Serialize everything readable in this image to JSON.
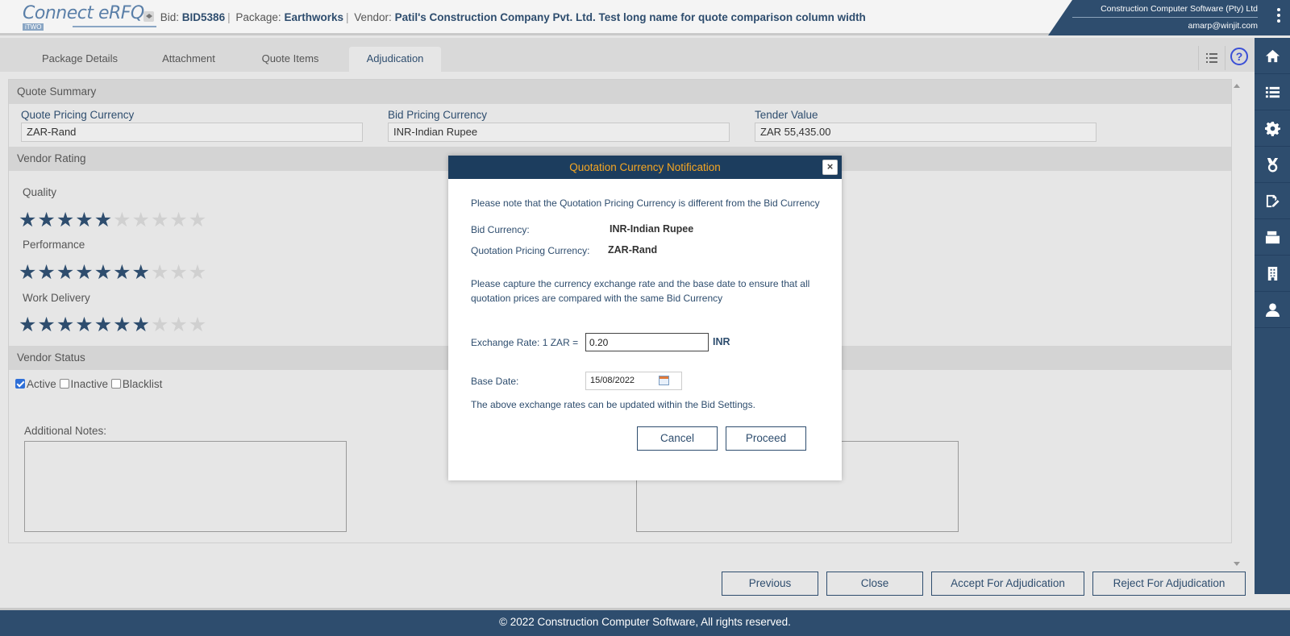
{
  "header": {
    "logo_text": "Connect eRFQ",
    "logo_sub": "iTWO",
    "bid_label": "Bid:",
    "bid_value": "BID5386",
    "package_label": "Package:",
    "package_value": "Earthworks",
    "vendor_label": "Vendor:",
    "vendor_value": "Patil's Construction Company Pvt. Ltd. Test long name for quote comparison column width",
    "company": "Construction Computer Software (Pty) Ltd",
    "user_email": "amarp@winjit.com"
  },
  "tabs": [
    {
      "label": "Package Details"
    },
    {
      "label": "Attachment"
    },
    {
      "label": "Quote Items"
    },
    {
      "label": "Adjudication",
      "active": true
    }
  ],
  "help_glyph": "?",
  "quote_summary": {
    "title": "Quote Summary",
    "quote_currency_label": "Quote Pricing Currency",
    "quote_currency_value": "ZAR-Rand",
    "bid_currency_label": "Bid Pricing Currency",
    "bid_currency_value": "INR-Indian Rupee",
    "tender_label": "Tender Value",
    "tender_value": "ZAR 55,435.00"
  },
  "vendor_rating": {
    "title": "Vendor Rating",
    "max_stars": 10,
    "ratings": [
      {
        "label": "Quality",
        "stars": 5
      },
      {
        "label": "Performance",
        "stars": 7
      },
      {
        "label": "Work Delivery",
        "stars": 7
      }
    ]
  },
  "vendor_status": {
    "title": "Vendor Status",
    "options": [
      {
        "label": "Active",
        "checked": true
      },
      {
        "label": "Inactive",
        "checked": false
      },
      {
        "label": "Blacklist",
        "checked": false
      }
    ]
  },
  "additional_notes_label": "Additional Notes:",
  "buttons": {
    "previous": "Previous",
    "close": "Close",
    "accept": "Accept For Adjudication",
    "reject": "Reject For Adjudication"
  },
  "footer": "© 2022 Construction Computer Software, All rights reserved.",
  "modal": {
    "title": "Quotation Currency Notification",
    "close_glyph": "×",
    "note": "Please note that the Quotation Pricing Currency is different from the Bid Currency",
    "bid_currency_label": "Bid Currency:",
    "bid_currency_value": "INR-Indian Rupee",
    "quote_currency_label": "Quotation Pricing Currency:",
    "quote_currency_value": "ZAR-Rand",
    "instruction": "Please capture the currency exchange rate and the base date to ensure that all quotation prices are compared with the same Bid Currency",
    "exchange_label": "Exchange Rate: 1 ZAR =",
    "exchange_value": "0.20",
    "exchange_unit": "INR",
    "base_date_label": "Base Date:",
    "base_date_value": "15/08/2022",
    "settings_note": "The above exchange rates can be updated within the Bid Settings.",
    "cancel": "Cancel",
    "proceed": "Proceed"
  }
}
